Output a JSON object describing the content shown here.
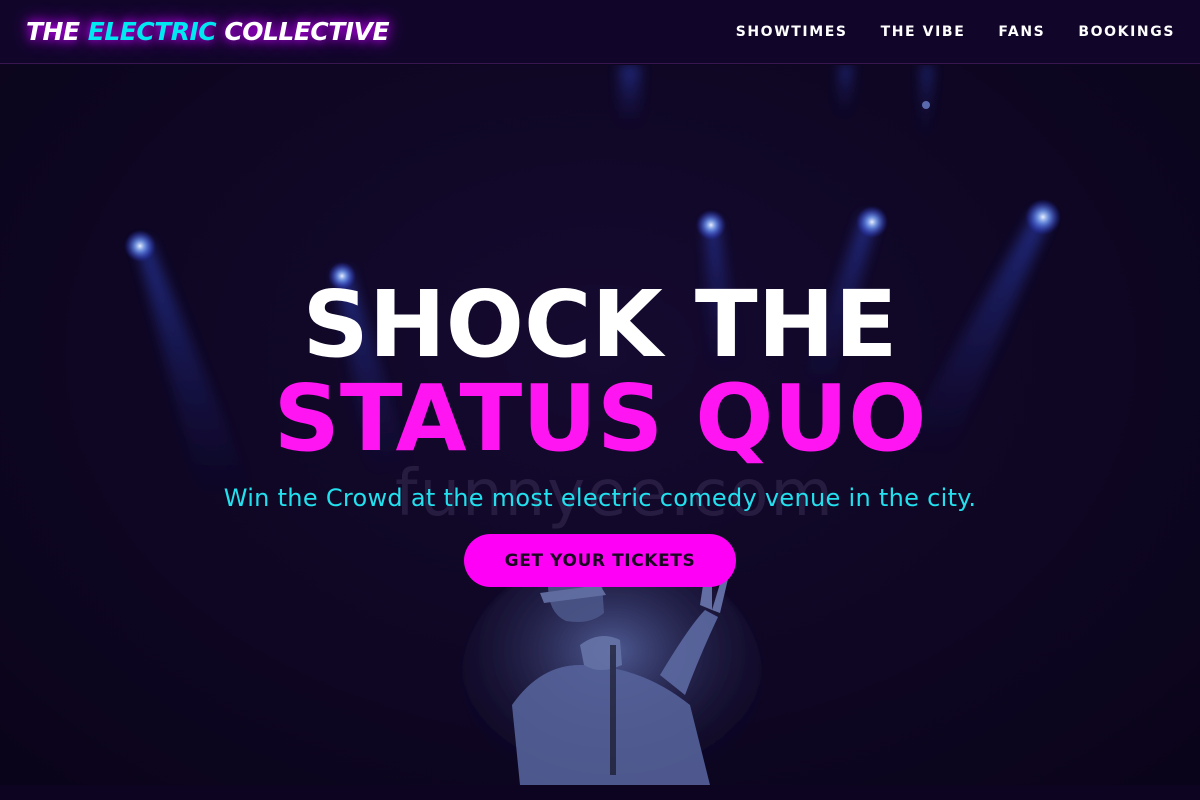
{
  "brand": {
    "part1": "THE ",
    "accent": "ELECTRIC",
    "part2": " COLLECTIVE"
  },
  "nav": {
    "items": [
      {
        "label": "SHOWTIMES"
      },
      {
        "label": "THE VIBE"
      },
      {
        "label": "FANS"
      },
      {
        "label": "BOOKINGS"
      }
    ]
  },
  "hero": {
    "headline_line1": "SHOCK THE",
    "headline_line2": "STATUS QUO",
    "subtitle": "Win the Crowd at the most electric comedy venue in the city.",
    "cta_label": "GET YOUR TICKETS",
    "watermark": "funnyee.com"
  },
  "colors": {
    "background": "#0d0620",
    "nav_background": "#11062a",
    "accent_cyan": "#00e8f0",
    "accent_magenta": "#ff14f2",
    "cta_background": "#ff00f6",
    "subtitle": "#22e0ee",
    "glow": "#c800ff"
  }
}
